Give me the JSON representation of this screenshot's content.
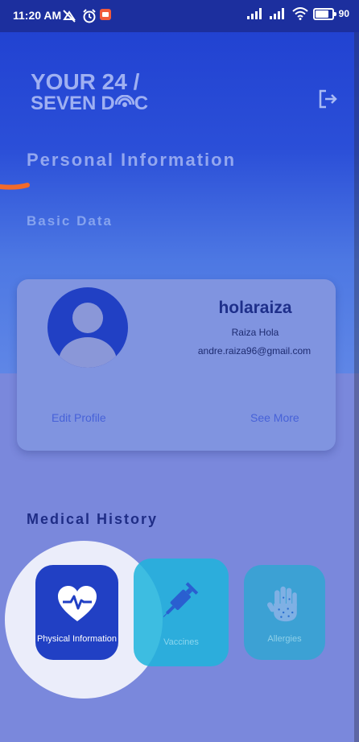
{
  "status_bar": {
    "time": "11:20 AM",
    "battery": "90",
    "battery_level": 0.9,
    "icons": [
      "no-disturb-icon",
      "alarm-icon",
      "app-notification-icon",
      "signal-icon",
      "signal-icon",
      "wifi-icon",
      "battery-icon"
    ]
  },
  "header": {
    "logo_line1": "YOUR 24 /",
    "logo_line2_a": "SEVEN",
    "logo_line2_b": "D",
    "logo_line2_c": "C",
    "logout_icon": "logout-icon"
  },
  "page": {
    "title": "Personal Information",
    "section_basic": "Basic Data",
    "section_medical": "Medical History"
  },
  "profile": {
    "username": "holaraiza",
    "full_name": "Raiza Hola",
    "email": "andre.raiza96@gmail.com",
    "edit_label": "Edit Profile",
    "see_more_label": "See More"
  },
  "medical": {
    "physical_label": "Physical Information",
    "vaccines_label": "Vaccines",
    "allergies_label": "Allergies"
  },
  "colors": {
    "primary": "#2140c4",
    "background": "#7a88dc",
    "accent_orange": "#f26a2a"
  }
}
